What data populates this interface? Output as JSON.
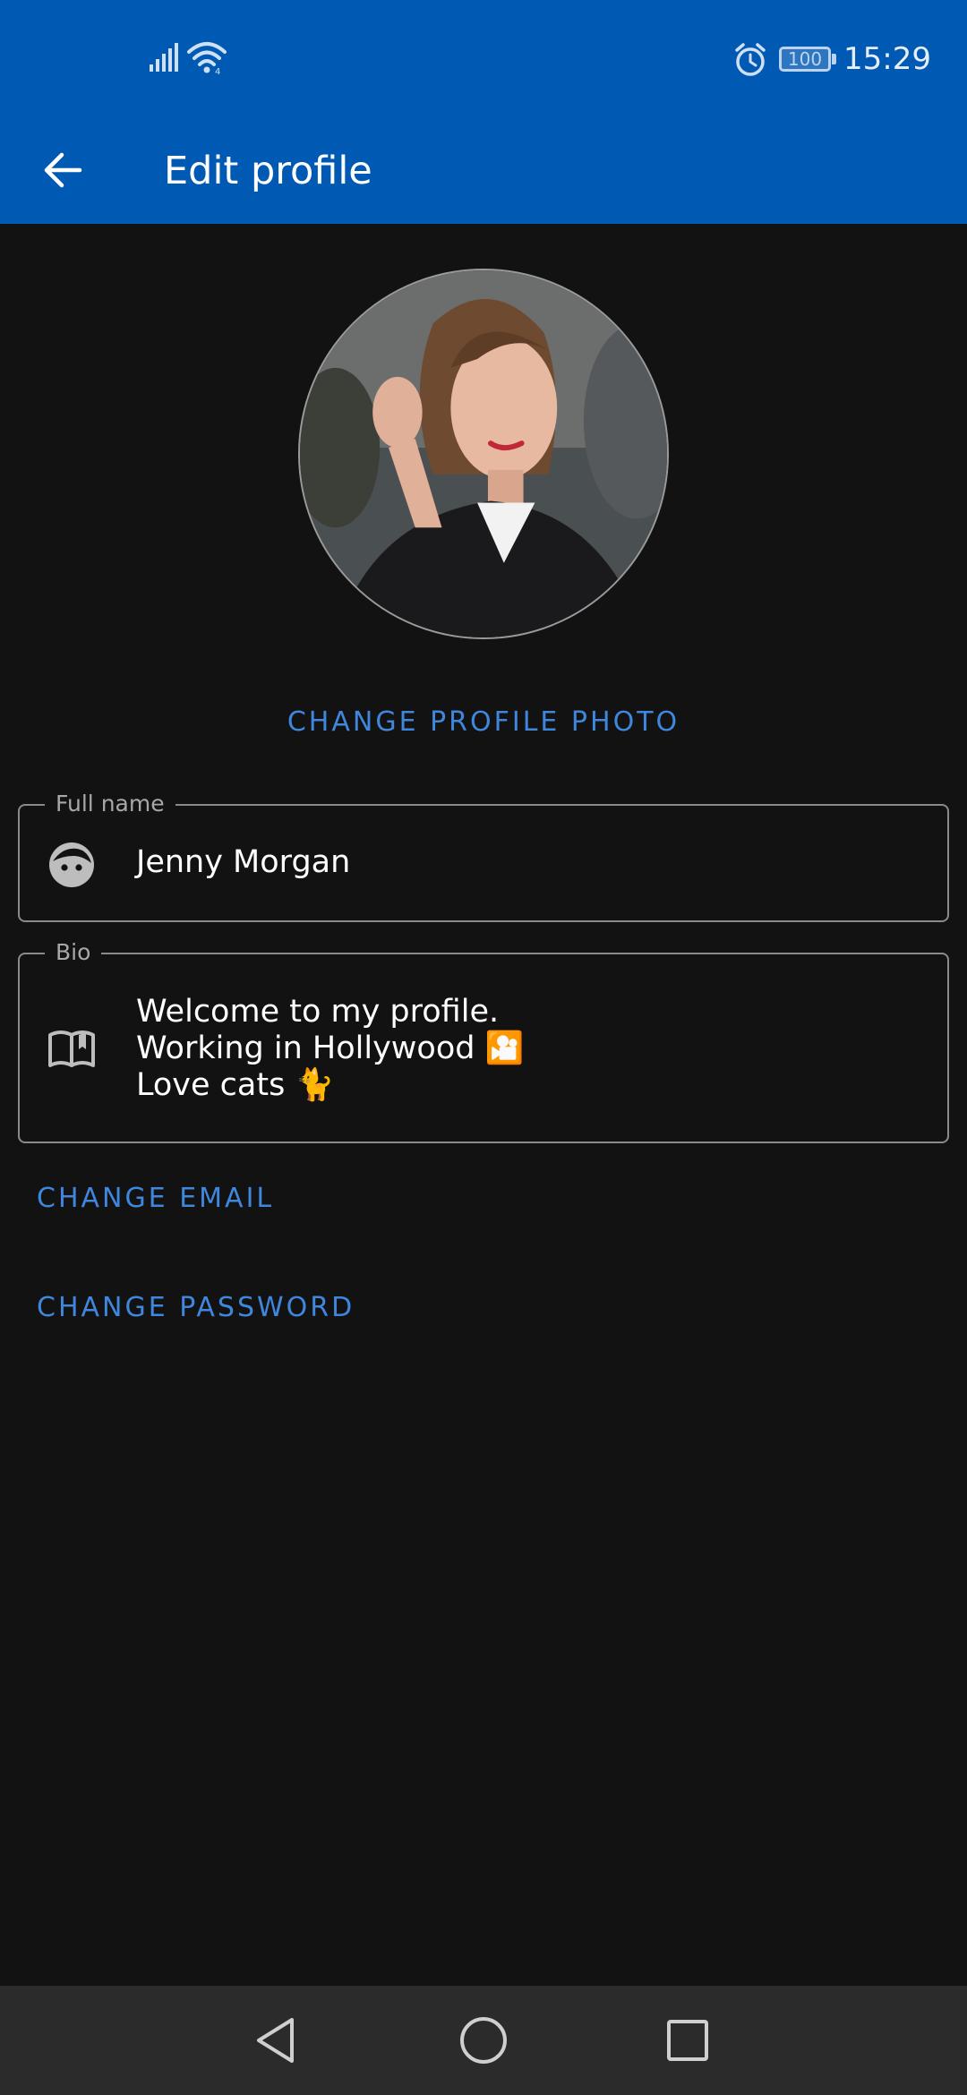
{
  "status_bar": {
    "time": "15:29",
    "battery_level": "100",
    "icons": [
      "signal-icon",
      "wifi-icon",
      "alarm-icon",
      "battery-icon"
    ]
  },
  "app_bar": {
    "back_icon": "arrow-left-icon",
    "title": "Edit profile"
  },
  "profile": {
    "avatar_icon": "profile-photo",
    "change_photo_label": "CHANGE PROFILE PHOTO"
  },
  "fields": {
    "full_name": {
      "label": "Full name",
      "value": "Jenny Morgan",
      "icon": "face-icon"
    },
    "bio": {
      "label": "Bio",
      "lines": [
        "Welcome to my profile.",
        "Working in Hollywood 🎦",
        "Love cats 🐈"
      ],
      "icon": "book-open-icon"
    }
  },
  "links": {
    "change_email": "CHANGE EMAIL",
    "change_password": "CHANGE PASSWORD"
  },
  "nav_bar": {
    "icons": [
      "nav-back-icon",
      "nav-home-icon",
      "nav-recent-icon"
    ]
  },
  "colors": {
    "primary": "#0059b3",
    "accent": "#3f86dd",
    "background": "#121212",
    "nav_bar": "#2b2b2b"
  }
}
